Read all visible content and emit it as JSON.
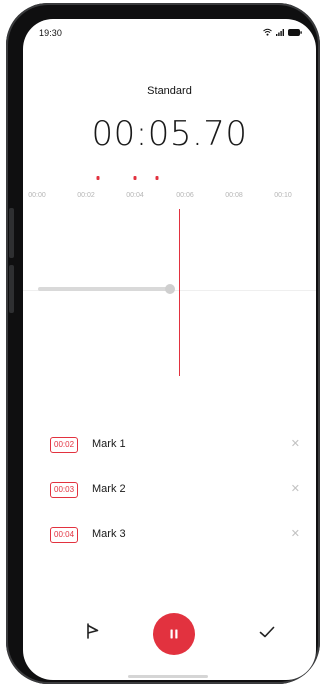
{
  "status_bar": {
    "time": "19:30",
    "icons": [
      "wifi-icon",
      "signal-icon",
      "battery-icon"
    ]
  },
  "recorder": {
    "mode": "Standard",
    "elapsed": "00:05.70"
  },
  "timeline": {
    "ticks": [
      "00:00",
      "00:02",
      "00:04",
      "00:06",
      "00:08",
      "00:10"
    ],
    "mark_color": "#e2323f"
  },
  "marks": [
    {
      "time": "00:02",
      "name": "Mark 1",
      "remove_icon": "close-icon"
    },
    {
      "time": "00:03",
      "name": "Mark 2",
      "remove_icon": "close-icon"
    },
    {
      "time": "00:04",
      "name": "Mark 3",
      "remove_icon": "close-icon"
    }
  ],
  "controls": {
    "left_icon": "flag-icon",
    "center_icon": "pause-icon",
    "right_icon": "check-icon"
  },
  "colors": {
    "accent": "#e2323f"
  }
}
